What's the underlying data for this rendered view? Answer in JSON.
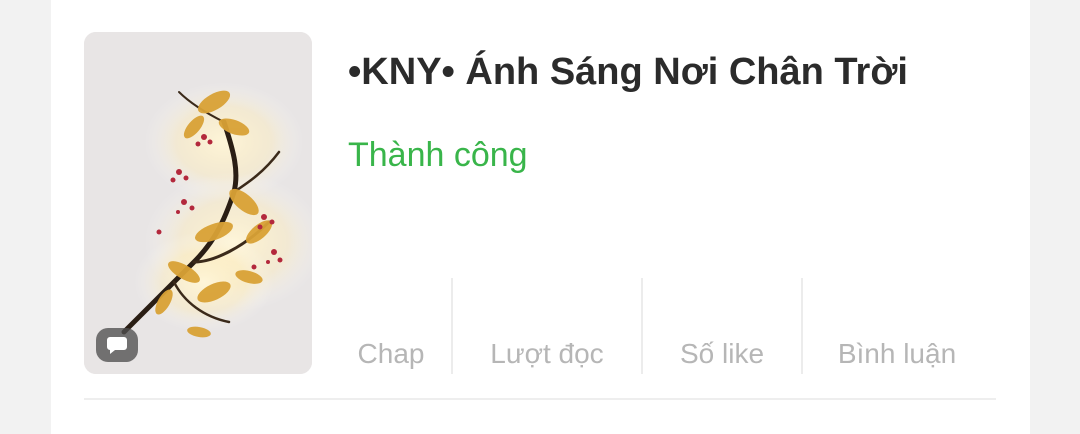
{
  "story": {
    "title": "•KNY• Ánh Sáng Nơi Chân Trời",
    "status": "Thành công",
    "cover_badge_icon": "chat-bubble-icon"
  },
  "stats": {
    "chap_label": "Chap",
    "reads_label": "Lượt đọc",
    "likes_label": "Số like",
    "comments_label": "Bình luận"
  },
  "colors": {
    "status": "#39b54a",
    "title": "#2b2b2b",
    "stat_label": "#b6b6b6"
  }
}
